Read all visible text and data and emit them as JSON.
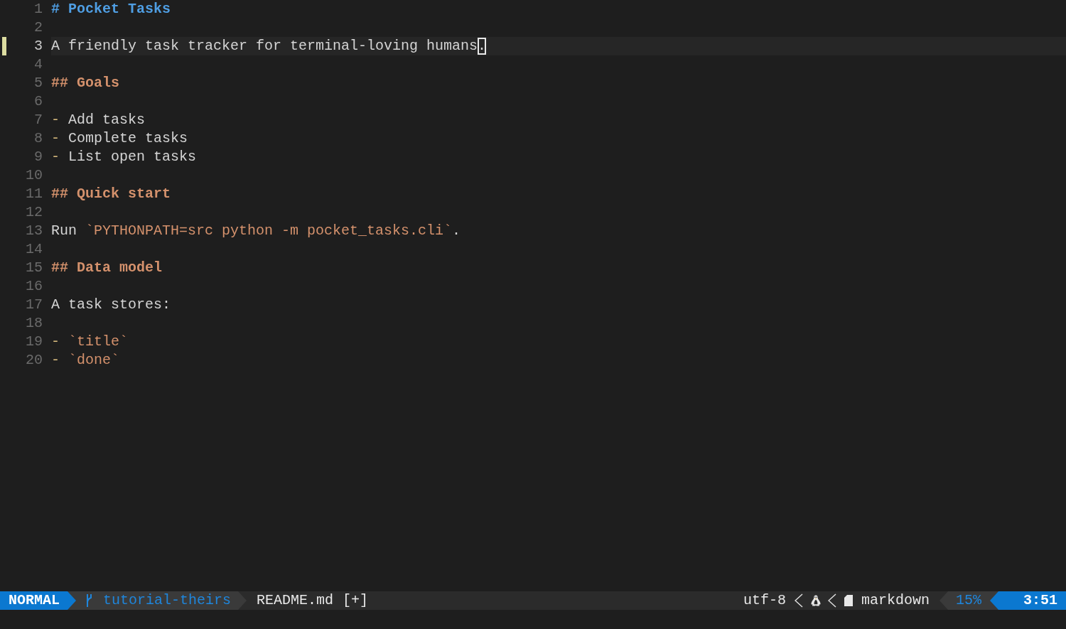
{
  "editor": {
    "lines": [
      {
        "number": "1",
        "current": false,
        "changed": false,
        "segments": [
          {
            "kind": "heading1",
            "text": "# Pocket Tasks"
          }
        ]
      },
      {
        "number": "2",
        "current": false,
        "changed": false
      },
      {
        "number": "3",
        "current": true,
        "changed": true,
        "segments": [
          {
            "kind": "text",
            "text": "A friendly task tracker for terminal-loving humans"
          },
          {
            "kind": "cursor",
            "text": "."
          }
        ]
      },
      {
        "number": "4",
        "current": false,
        "changed": false
      },
      {
        "number": "5",
        "current": false,
        "changed": false,
        "segments": [
          {
            "kind": "heading2",
            "text": "## Goals"
          }
        ]
      },
      {
        "number": "6",
        "current": false,
        "changed": false
      },
      {
        "number": "7",
        "current": false,
        "changed": false,
        "segments": [
          {
            "kind": "bullet",
            "text": "-"
          },
          {
            "kind": "text",
            "text": "Add tasks"
          }
        ]
      },
      {
        "number": "8",
        "current": false,
        "changed": false,
        "segments": [
          {
            "kind": "bullet",
            "text": "-"
          },
          {
            "kind": "text",
            "text": "Complete tasks"
          }
        ]
      },
      {
        "number": "9",
        "current": false,
        "changed": false,
        "segments": [
          {
            "kind": "bullet",
            "text": "-"
          },
          {
            "kind": "text",
            "text": "List open tasks"
          }
        ]
      },
      {
        "number": "10",
        "current": false,
        "changed": false
      },
      {
        "number": "11",
        "current": false,
        "changed": false,
        "segments": [
          {
            "kind": "heading2",
            "text": "## Quick start"
          }
        ]
      },
      {
        "number": "12",
        "current": false,
        "changed": false
      },
      {
        "number": "13",
        "current": false,
        "changed": false,
        "segments": [
          {
            "kind": "text",
            "text": "Run "
          },
          {
            "kind": "code",
            "text": "`PYTHONPATH=src python -m pocket_tasks.cli`"
          },
          {
            "kind": "text",
            "text": "."
          }
        ]
      },
      {
        "number": "14",
        "current": false,
        "changed": false
      },
      {
        "number": "15",
        "current": false,
        "changed": false,
        "segments": [
          {
            "kind": "heading2",
            "text": "## Data model"
          }
        ]
      },
      {
        "number": "16",
        "current": false,
        "changed": false
      },
      {
        "number": "17",
        "current": false,
        "changed": false,
        "segments": [
          {
            "kind": "text",
            "text": "A task stores:"
          }
        ]
      },
      {
        "number": "18",
        "current": false,
        "changed": false
      },
      {
        "number": "19",
        "current": false,
        "changed": false,
        "segments": [
          {
            "kind": "bullet",
            "text": "-"
          },
          {
            "kind": "code",
            "text": "`title`"
          }
        ]
      },
      {
        "number": "20",
        "current": false,
        "changed": false,
        "segments": [
          {
            "kind": "bullet",
            "text": "-"
          },
          {
            "kind": "code",
            "text": "`done`"
          }
        ]
      }
    ]
  },
  "status_bar": {
    "mode": "NORMAL",
    "branch": "tutorial-theirs",
    "file": "README.md",
    "modified_flag": "[+]",
    "encoding": "utf-8",
    "filetype": "markdown",
    "progress": "15%",
    "position": "3:51"
  }
}
